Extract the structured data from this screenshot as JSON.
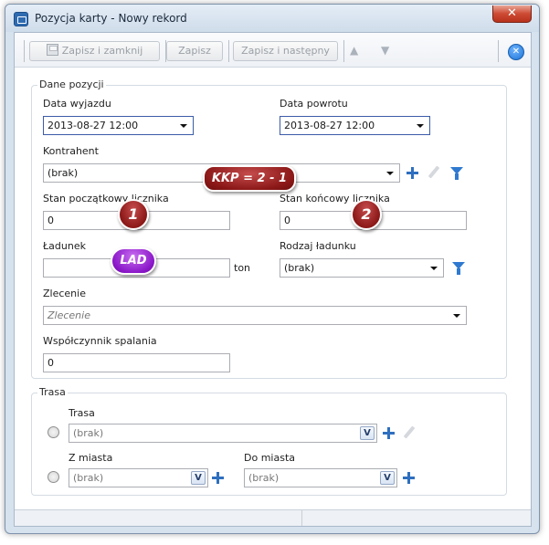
{
  "window": {
    "title": "Pozycja karty - Nowy rekord",
    "close_glyph": "✕"
  },
  "toolbar": {
    "save_close": "Zapisz i zamknij",
    "save": "Zapisz",
    "save_next": "Zapisz i następny",
    "up_glyph": "▲",
    "down_glyph": "▼",
    "close_glyph": "✕"
  },
  "dane": {
    "legend": "Dane pozycji",
    "data_wyjazdu_label": "Data wyjazdu",
    "data_wyjazdu_value": "2013-08-27 12:00",
    "data_powrotu_label": "Data powrotu",
    "data_powrotu_value": "2013-08-27 12:00",
    "kontrahent_label": "Kontrahent",
    "kontrahent_value": "(brak)",
    "stan_pocz_label": "Stan początkowy licznika",
    "stan_pocz_value": "0",
    "stan_konc_label": "Stan końcowy licznika",
    "stan_konc_value": "0",
    "ladunek_label": "Ładunek",
    "ladunek_value": "",
    "ladunek_unit": "ton",
    "rodzaj_label": "Rodzaj ładunku",
    "rodzaj_value": "(brak)",
    "zlecenie_label": "Zlecenie",
    "zlecenie_placeholder": "Zlecenie",
    "wsp_label": "Współczynnik spalania",
    "wsp_value": "0"
  },
  "trasa": {
    "legend": "Trasa",
    "trasa_label": "Trasa",
    "trasa_value": "(brak)",
    "z_miasta_label": "Z miasta",
    "z_miasta_value": "(brak)",
    "do_miasta_label": "Do miasta",
    "do_miasta_value": "(brak)",
    "v_glyph": "V"
  },
  "annotations": {
    "kkp": "KKP = 2 - 1",
    "one": "1",
    "two": "2",
    "lad": "LAD"
  },
  "colors": {
    "accent": "#2e6fbf",
    "annotation_red": "#8c1818",
    "annotation_purple": "#8b18c9"
  },
  "icons": {
    "app": "app-icon",
    "add": "plus-icon",
    "edit": "pencil-icon",
    "filter": "filter-icon",
    "disk": "disk-icon"
  }
}
